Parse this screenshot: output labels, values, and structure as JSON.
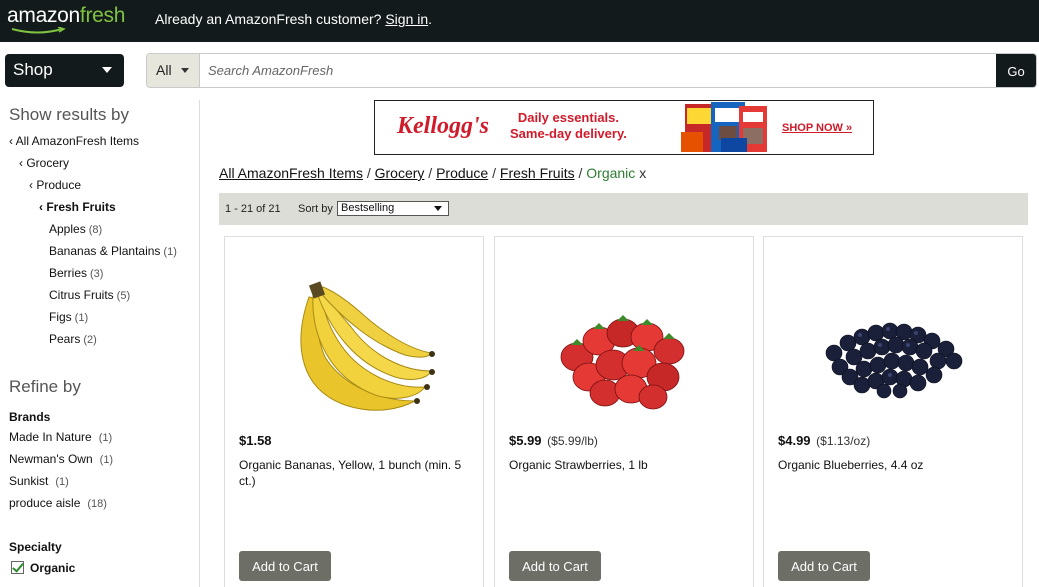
{
  "header": {
    "logo_main": "amazon",
    "logo_accent": "fresh",
    "message": "Already an AmazonFresh customer?",
    "sign_in": "Sign in",
    "period": "."
  },
  "search": {
    "shop_label": "Shop",
    "category": "All",
    "placeholder": "Search AmazonFresh",
    "go_label": "Go"
  },
  "sidebar": {
    "show_results_heading": "Show results by",
    "nav": [
      {
        "label": "‹ All AmazonFresh Items"
      },
      {
        "label": "‹ Grocery"
      },
      {
        "label": "‹ Produce"
      },
      {
        "label": "‹ Fresh Fruits"
      }
    ],
    "subcategories": [
      {
        "label": "Apples",
        "count": "(8)"
      },
      {
        "label": "Bananas & Plantains",
        "count": "(1)"
      },
      {
        "label": "Berries",
        "count": "(3)"
      },
      {
        "label": "Citrus Fruits",
        "count": "(5)"
      },
      {
        "label": "Figs",
        "count": "(1)"
      },
      {
        "label": "Pears",
        "count": "(2)"
      }
    ],
    "refine_heading": "Refine by",
    "brands_label": "Brands",
    "brands": [
      {
        "label": "Made In Nature",
        "count": "(1)"
      },
      {
        "label": "Newman's Own",
        "count": "(1)"
      },
      {
        "label": "Sunkist",
        "count": "(1)"
      },
      {
        "label": "produce aisle",
        "count": "(18)"
      }
    ],
    "specialty_label": "Specialty",
    "specialty_option": "Organic",
    "specialty_checked": true
  },
  "ad": {
    "brand": "Kellogg's",
    "line1": "Daily essentials.",
    "line2": "Same-day delivery.",
    "cta": "SHOP NOW »",
    "accent_color": "#d11a2a"
  },
  "breadcrumb": {
    "items": [
      "All AmazonFresh Items",
      "Grocery",
      "Produce",
      "Fresh Fruits"
    ],
    "separator": "/",
    "current": "Organic",
    "remove": "x"
  },
  "results": {
    "count_text": "1 - 21 of 21",
    "sort_label": "Sort by",
    "sort_value": "Bestselling"
  },
  "products": [
    {
      "image": "bananas",
      "price": "$1.58",
      "unit_price": "",
      "name": "Organic Bananas, Yellow, 1 bunch (min. 5 ct.)",
      "button": "Add to Cart"
    },
    {
      "image": "strawberries",
      "price": "$5.99",
      "unit_price": "($5.99/lb)",
      "name": "Organic Strawberries, 1 lb",
      "button": "Add to Cart"
    },
    {
      "image": "blueberries",
      "price": "$4.99",
      "unit_price": "($1.13/oz)",
      "name": "Organic Blueberries, 4.4 oz",
      "button": "Add to Cart"
    }
  ],
  "colors": {
    "header_bg": "#131a1b",
    "logo_accent": "#7fc241",
    "breadcrumb_current": "#2e7d32",
    "button_bg": "#6d6e66",
    "results_bar_bg": "#dcddd6"
  }
}
